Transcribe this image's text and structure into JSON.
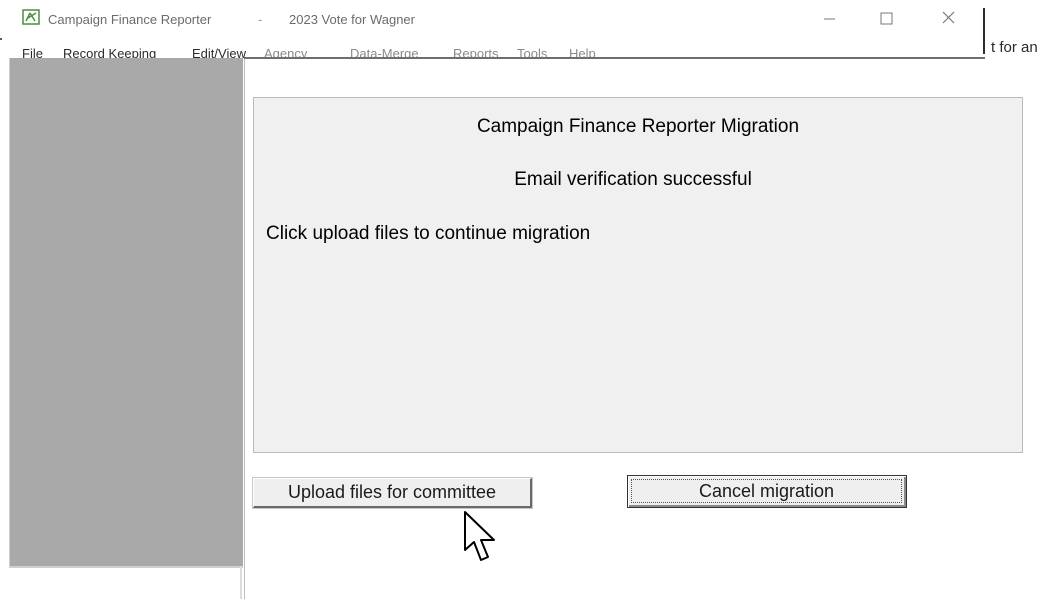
{
  "window": {
    "app_title": "Campaign Finance Reporter",
    "separator": "-",
    "document_title": "2023 Vote for Wagner",
    "controls": [
      "minimize-icon",
      "maximize-icon",
      "close-icon"
    ],
    "behind_window_text": "t for an"
  },
  "menu": {
    "items": [
      "File",
      "Record Keeping",
      "Edit/View",
      "Agency",
      "Data-Merge",
      "Reports",
      "Tools",
      "Help"
    ]
  },
  "dialog": {
    "heading": "Campaign Finance Reporter Migration",
    "status": "Email verification successful",
    "instruction": "Click upload files to continue migration",
    "upload_button": "Upload files for committee",
    "cancel_button": "Cancel migration"
  },
  "colors": {
    "side_panel": "#a9a9a9",
    "message_panel": "#f0f0f0",
    "app_icon": "#4a8f3c"
  }
}
